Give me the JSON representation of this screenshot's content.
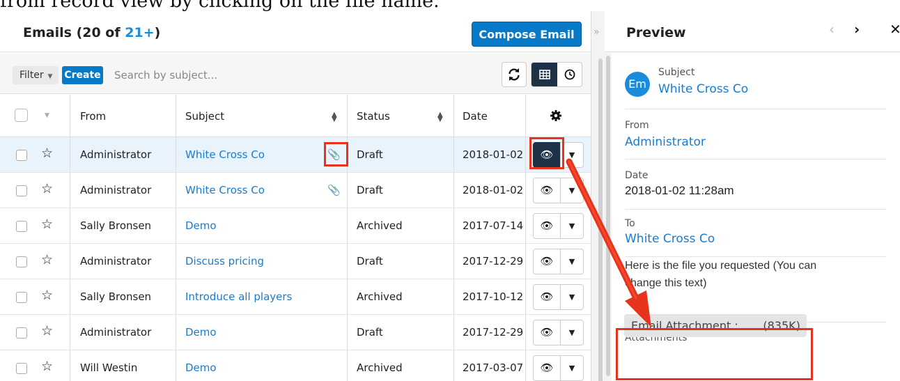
{
  "caption": "from record view by clicking on the file name.",
  "list": {
    "title": "Emails",
    "count_prefix": "(20 of ",
    "count_link": "21+",
    "count_suffix": ")",
    "compose_label": "Compose Email",
    "filter_label": "Filter",
    "create_label": "Create",
    "search_placeholder": "Search by subject...",
    "columns": [
      "From",
      "Subject",
      "Status",
      "Date"
    ],
    "rows": [
      {
        "from": "Administrator",
        "subject": "White Cross Co",
        "status": "Draft",
        "date": "2018-01-02",
        "attachment": true,
        "selected": true
      },
      {
        "from": "Administrator",
        "subject": "White Cross Co",
        "status": "Draft",
        "date": "2018-01-02",
        "attachment": true,
        "selected": false
      },
      {
        "from": "Sally Bronsen",
        "subject": "Demo",
        "status": "Archived",
        "date": "2017-07-14",
        "attachment": false,
        "selected": false
      },
      {
        "from": "Administrator",
        "subject": "Discuss pricing",
        "status": "Draft",
        "date": "2017-12-29",
        "attachment": false,
        "selected": false
      },
      {
        "from": "Sally Bronsen",
        "subject": "Introduce all players",
        "status": "Archived",
        "date": "2017-10-12",
        "attachment": false,
        "selected": false
      },
      {
        "from": "Administrator",
        "subject": "Demo",
        "status": "Draft",
        "date": "2017-12-29",
        "attachment": false,
        "selected": false
      },
      {
        "from": "Will Westin",
        "subject": "Demo",
        "status": "Archived",
        "date": "2017-03-07",
        "attachment": false,
        "selected": false
      }
    ]
  },
  "preview": {
    "title": "Preview",
    "avatar_initials": "Em",
    "subject_label": "Subject",
    "subject_value": "White Cross Co",
    "from_label": "From",
    "from_value": "Administrator",
    "date_label": "Date",
    "date_value": "2018-01-02 11:28am",
    "to_label": "To",
    "to_value": "White Cross Co",
    "body_line1": "Here is the file you requested (You can",
    "body_line2": "change this text)",
    "attachments_label": "Attachments",
    "attachment_name": "Email Attachment : ...",
    "attachment_size": "(835K)"
  },
  "colors": {
    "accent": "#0679c8",
    "link": "#1a7ccf",
    "highlight": "#e8331c",
    "dark": "#1d3247"
  }
}
